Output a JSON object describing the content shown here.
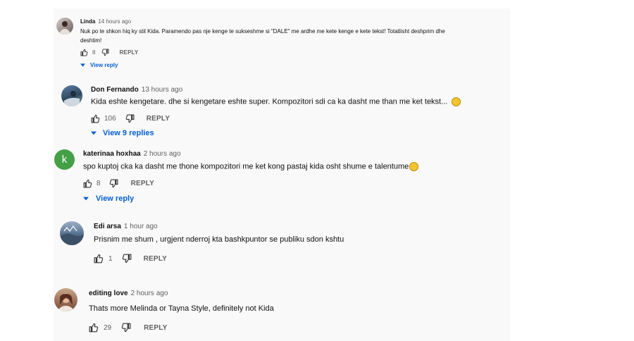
{
  "comments": [
    {
      "author": "Linda",
      "time": "14 hours ago",
      "text_line1": "Nuk po te shkon hiq ky stil Kida. Paramendo pas nje kenge te sukseshme si \"DALE\" me ardhe me kete kenge e kete tekst! Totatlisht deshprim dhe",
      "text_line2": "deshtim!",
      "likes": "8",
      "reply_label": "REPLY",
      "view_replies": "View reply"
    },
    {
      "author": "Don Fernando",
      "time": "13 hours ago",
      "text": "Kida eshte kengetare. dhe si kengetare eshte super. Kompozitori sdi ca ka dasht me than me ket tekst...",
      "likes": "106",
      "reply_label": "REPLY",
      "view_replies": "View 9 replies"
    },
    {
      "author": "katerinaa hoxhaa",
      "avatar_letter": "k",
      "time": "2 hours ago",
      "text": "spo kuptoj cka ka dasht me thone kompozitori me ket kong pastaj kida osht shume  e talentume",
      "likes": "8",
      "reply_label": "REPLY",
      "view_replies": "View reply"
    },
    {
      "author": "Edi arsa",
      "time": "1 hour ago",
      "text": "Prisnim me shum , urgjent nderroj kta bashkpuntor se publiku  sdon kshtu",
      "likes": "1",
      "reply_label": "REPLY"
    },
    {
      "author": "editing love",
      "time": "2 hours ago",
      "text": "Thats more Melinda or Tayna Style, definitely not Kida",
      "likes": "29",
      "reply_label": "REPLY"
    }
  ],
  "colors": {
    "link_blue": "#065fd4",
    "meta_gray": "#606060",
    "avatar_green": "#43a047",
    "panel_bg": "#f9f9f9"
  },
  "icons": [
    "thumb-up-icon",
    "thumb-down-icon",
    "caret-down-icon"
  ]
}
